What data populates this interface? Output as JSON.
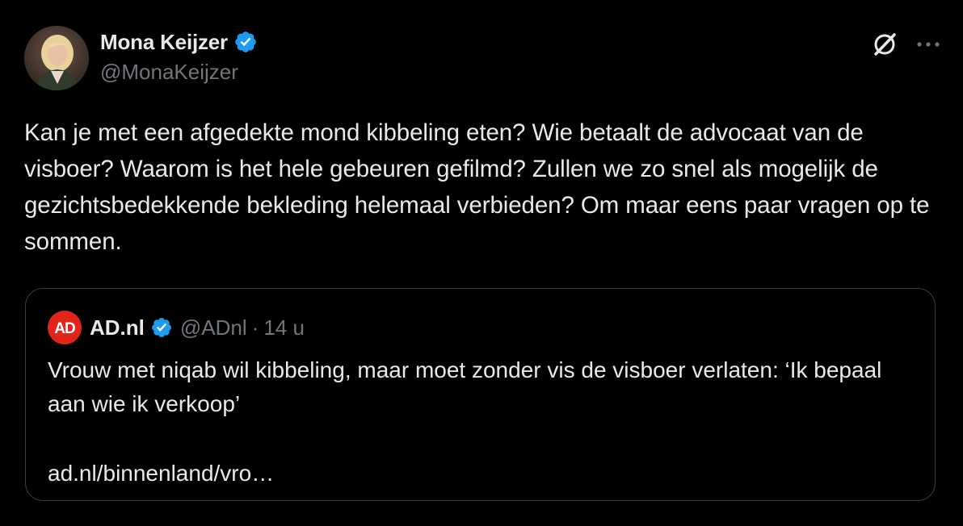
{
  "author": {
    "name": "Mona Keijzer",
    "handle": "@MonaKeijzer",
    "verified": true
  },
  "actions": {
    "grok_icon": "grok-icon",
    "more_icon": "more-icon",
    "more_label": "···"
  },
  "tweet": {
    "text": "Kan je met een afgedekte mond kibbeling eten? Wie betaalt de advocaat van de visboer? Waarom is het hele gebeuren gefilmd? Zullen we zo snel als mogelijk de gezichtsbedekkende bekleding helemaal verbieden? Om maar eens paar vragen op te sommen."
  },
  "quote": {
    "logo_text": "AD",
    "name": "AD.nl",
    "verified": true,
    "handle": "@ADnl",
    "separator": "·",
    "time": "14 u",
    "text": "Vrouw met niqab wil kibbeling, maar moet zonder vis de visboer verlaten: ‘Ik bepaal aan wie ik verkoop’",
    "link": "ad.nl/binnenland/vro…"
  },
  "colors": {
    "background": "#000000",
    "text": "#e7e9ea",
    "secondary": "#71767b",
    "verified_blue": "#1d9bf0",
    "ad_red": "#e1251b",
    "border": "#3a3e42"
  }
}
